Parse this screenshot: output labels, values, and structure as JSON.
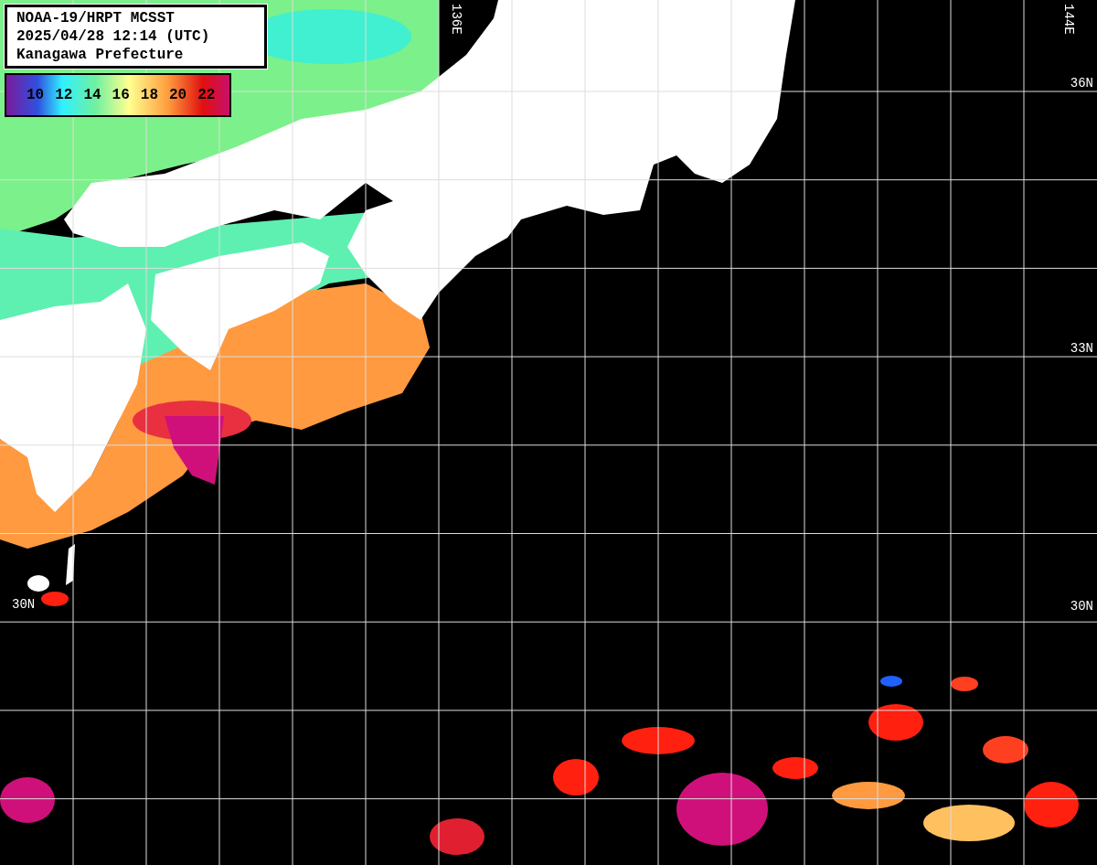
{
  "title_box": {
    "lines": [
      "NOAA-19/HRPT MCSST",
      "2025/04/28 12:14 (UTC)",
      "Kanagawa Prefecture"
    ]
  },
  "legend": {
    "labels": [
      "10",
      "12",
      "14",
      "16",
      "18",
      "20",
      "22"
    ]
  },
  "map": {
    "longitude_labels": [
      "136E",
      "144E"
    ],
    "latitude_labels_right": [
      "36N",
      "33N",
      "30N"
    ],
    "latitude_labels_left": [
      "30N"
    ]
  }
}
